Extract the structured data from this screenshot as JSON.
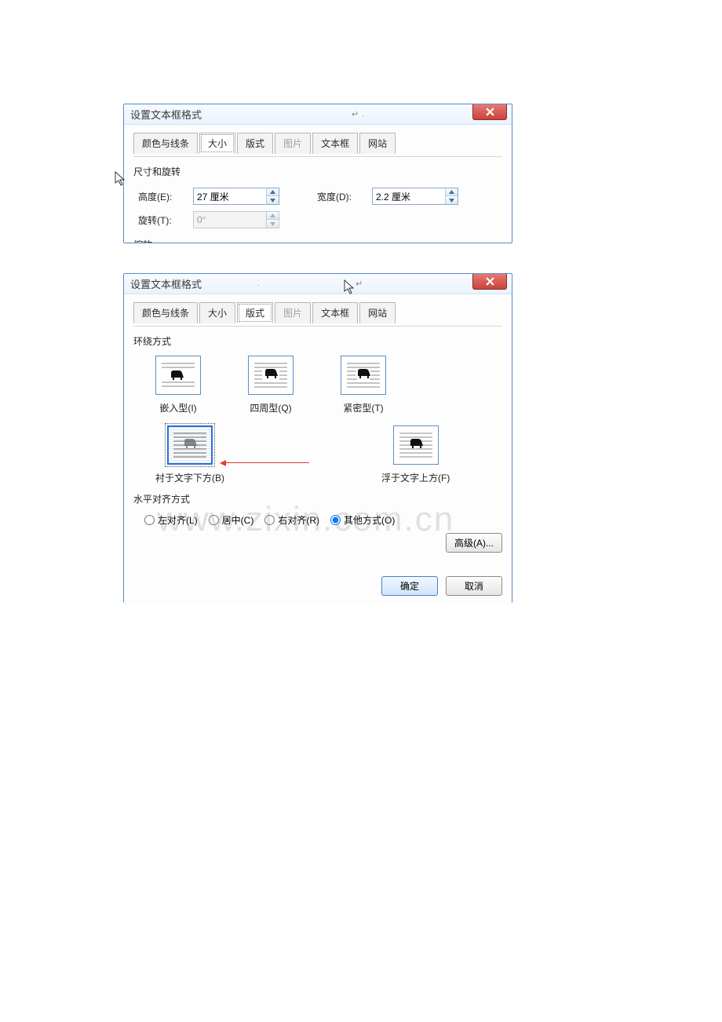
{
  "dialog_title": "设置文本框格式",
  "tabs": {
    "colors_lines": "颜色与线条",
    "size": "大小",
    "layout": "版式",
    "picture": "图片",
    "textbox": "文本框",
    "website": "网站"
  },
  "size_tab": {
    "group_dim": "尺寸和旋转",
    "height_label": "高度(E):",
    "height_value": "27 厘米",
    "width_label": "宽度(D):",
    "width_value": "2.2 厘米",
    "rotate_label": "旋转(T):",
    "rotate_value": "0°",
    "group_scale": "缩放"
  },
  "layout_tab": {
    "group_wrap": "环绕方式",
    "inline": "嵌入型(I)",
    "square": "四周型(Q)",
    "tight": "紧密型(T)",
    "behind": "衬于文字下方(B)",
    "front": "浮于文字上方(F)",
    "group_align": "水平对齐方式",
    "align_left": "左对齐(L)",
    "align_center": "居中(C)",
    "align_right": "右对齐(R)",
    "align_other": "其他方式(O)",
    "advanced": "高级(A)..."
  },
  "watermark": "www.zixin.com.cn",
  "buttons": {
    "ok": "确定",
    "cancel": "取消"
  }
}
